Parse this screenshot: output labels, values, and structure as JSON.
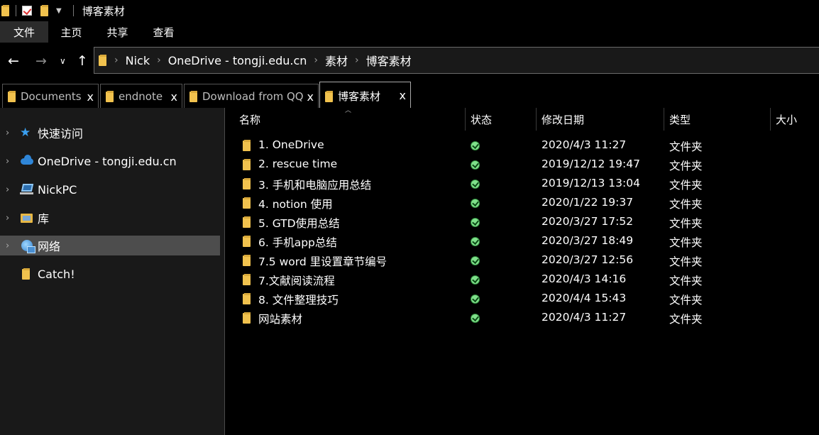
{
  "window": {
    "title": "博客素材"
  },
  "ribbon": {
    "tabs": [
      "文件",
      "主页",
      "共享",
      "查看"
    ]
  },
  "nav": {
    "back_icon": "back-arrow-icon",
    "forward_icon": "forward-arrow-icon",
    "recent_icon": "chevron-down-icon",
    "up_icon": "up-arrow-icon"
  },
  "address": {
    "crumbs": [
      "Nick",
      "OneDrive - tongji.edu.cn",
      "素材",
      "博客素材"
    ]
  },
  "tabs": [
    {
      "label": "Documents",
      "active": false
    },
    {
      "label": "endnote",
      "active": false
    },
    {
      "label": "Download from QQ",
      "active": false
    },
    {
      "label": "博客素材",
      "active": true
    }
  ],
  "sidebar": {
    "items": [
      {
        "label": "快速访问",
        "icon": "star-icon",
        "expandable": true
      },
      {
        "label": "OneDrive - tongji.edu.cn",
        "icon": "cloud-icon",
        "expandable": true
      },
      {
        "label": "NickPC",
        "icon": "computer-icon",
        "expandable": true
      },
      {
        "label": "库",
        "icon": "library-icon",
        "expandable": true
      },
      {
        "label": "网络",
        "icon": "network-icon",
        "expandable": true,
        "selected": true
      },
      {
        "label": "Catch!",
        "icon": "folder-icon",
        "expandable": false
      }
    ]
  },
  "columns": {
    "name": "名称",
    "status": "状态",
    "modified": "修改日期",
    "type": "类型",
    "size": "大小"
  },
  "files": [
    {
      "name": "1. OneDrive",
      "modified": "2020/4/3 11:27",
      "type": "文件夹"
    },
    {
      "name": "2. rescue time",
      "modified": "2019/12/12 19:47",
      "type": "文件夹"
    },
    {
      "name": "3. 手机和电脑应用总结",
      "modified": "2019/12/13 13:04",
      "type": "文件夹"
    },
    {
      "name": "4. notion 使用",
      "modified": "2020/1/22 19:37",
      "type": "文件夹"
    },
    {
      "name": "5. GTD使用总结",
      "modified": "2020/3/27 17:52",
      "type": "文件夹"
    },
    {
      "name": "6. 手机app总结",
      "modified": "2020/3/27 18:49",
      "type": "文件夹"
    },
    {
      "name": "7.5 word 里设置章节编号",
      "modified": "2020/3/27 12:56",
      "type": "文件夹"
    },
    {
      "name": "7.文献阅读流程",
      "modified": "2020/4/3 14:16",
      "type": "文件夹"
    },
    {
      "name": "8. 文件整理技巧",
      "modified": "2020/4/4 15:43",
      "type": "文件夹"
    },
    {
      "name": "网站素材",
      "modified": "2020/4/3 11:27",
      "type": "文件夹"
    }
  ],
  "status_icon": "synced-check-icon",
  "colors": {
    "background": "#000000",
    "sidebar": "#191919",
    "selected": "#4d4d4d",
    "folder": "#f1c24e",
    "synced": "#7fe08a"
  }
}
